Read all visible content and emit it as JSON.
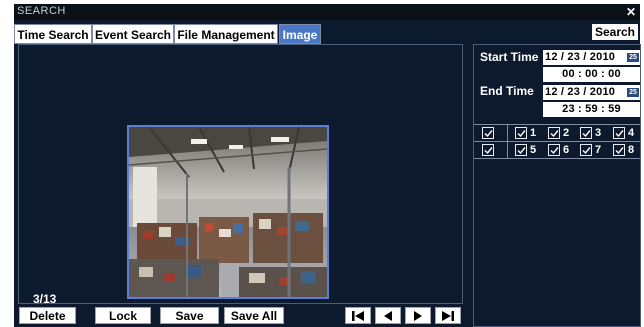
{
  "window": {
    "title": "SEARCH",
    "close_glyph": "✕"
  },
  "tabs": [
    {
      "label": "Time Search",
      "active": false
    },
    {
      "label": "Event Search",
      "active": false
    },
    {
      "label": "File Management",
      "active": false
    },
    {
      "label": "Image",
      "active": true
    }
  ],
  "search_button": "Search",
  "preview": {
    "counter": "3/13",
    "image_alt": "warehouse camera snapshot"
  },
  "actions": {
    "delete": "Delete",
    "lock": "Lock",
    "save": "Save",
    "save_all": "Save All"
  },
  "navigation": {
    "first_icon": "skip-first-icon",
    "prev_icon": "prev-icon",
    "next_icon": "next-icon",
    "last_icon": "skip-last-icon"
  },
  "time": {
    "start_label": "Start Time",
    "start_date": "12 / 23 / 2010",
    "start_time": "00 : 00 : 00",
    "end_label": "End Time",
    "end_date": "12 / 23 / 2010",
    "end_time": "23 : 59 : 59",
    "calendar_badge": "25"
  },
  "channels": {
    "row1": {
      "all_checked": true,
      "items": [
        {
          "label": "1",
          "checked": true
        },
        {
          "label": "2",
          "checked": true
        },
        {
          "label": "3",
          "checked": true
        },
        {
          "label": "4",
          "checked": true
        }
      ]
    },
    "row2": {
      "all_checked": true,
      "items": [
        {
          "label": "5",
          "checked": true
        },
        {
          "label": "6",
          "checked": true
        },
        {
          "label": "7",
          "checked": true
        },
        {
          "label": "8",
          "checked": true
        }
      ]
    }
  },
  "colors": {
    "background": "#0d1a2e",
    "active_tab": "#4a78c6",
    "border": "#4c5d7a",
    "image_border": "#5c7fd6"
  }
}
